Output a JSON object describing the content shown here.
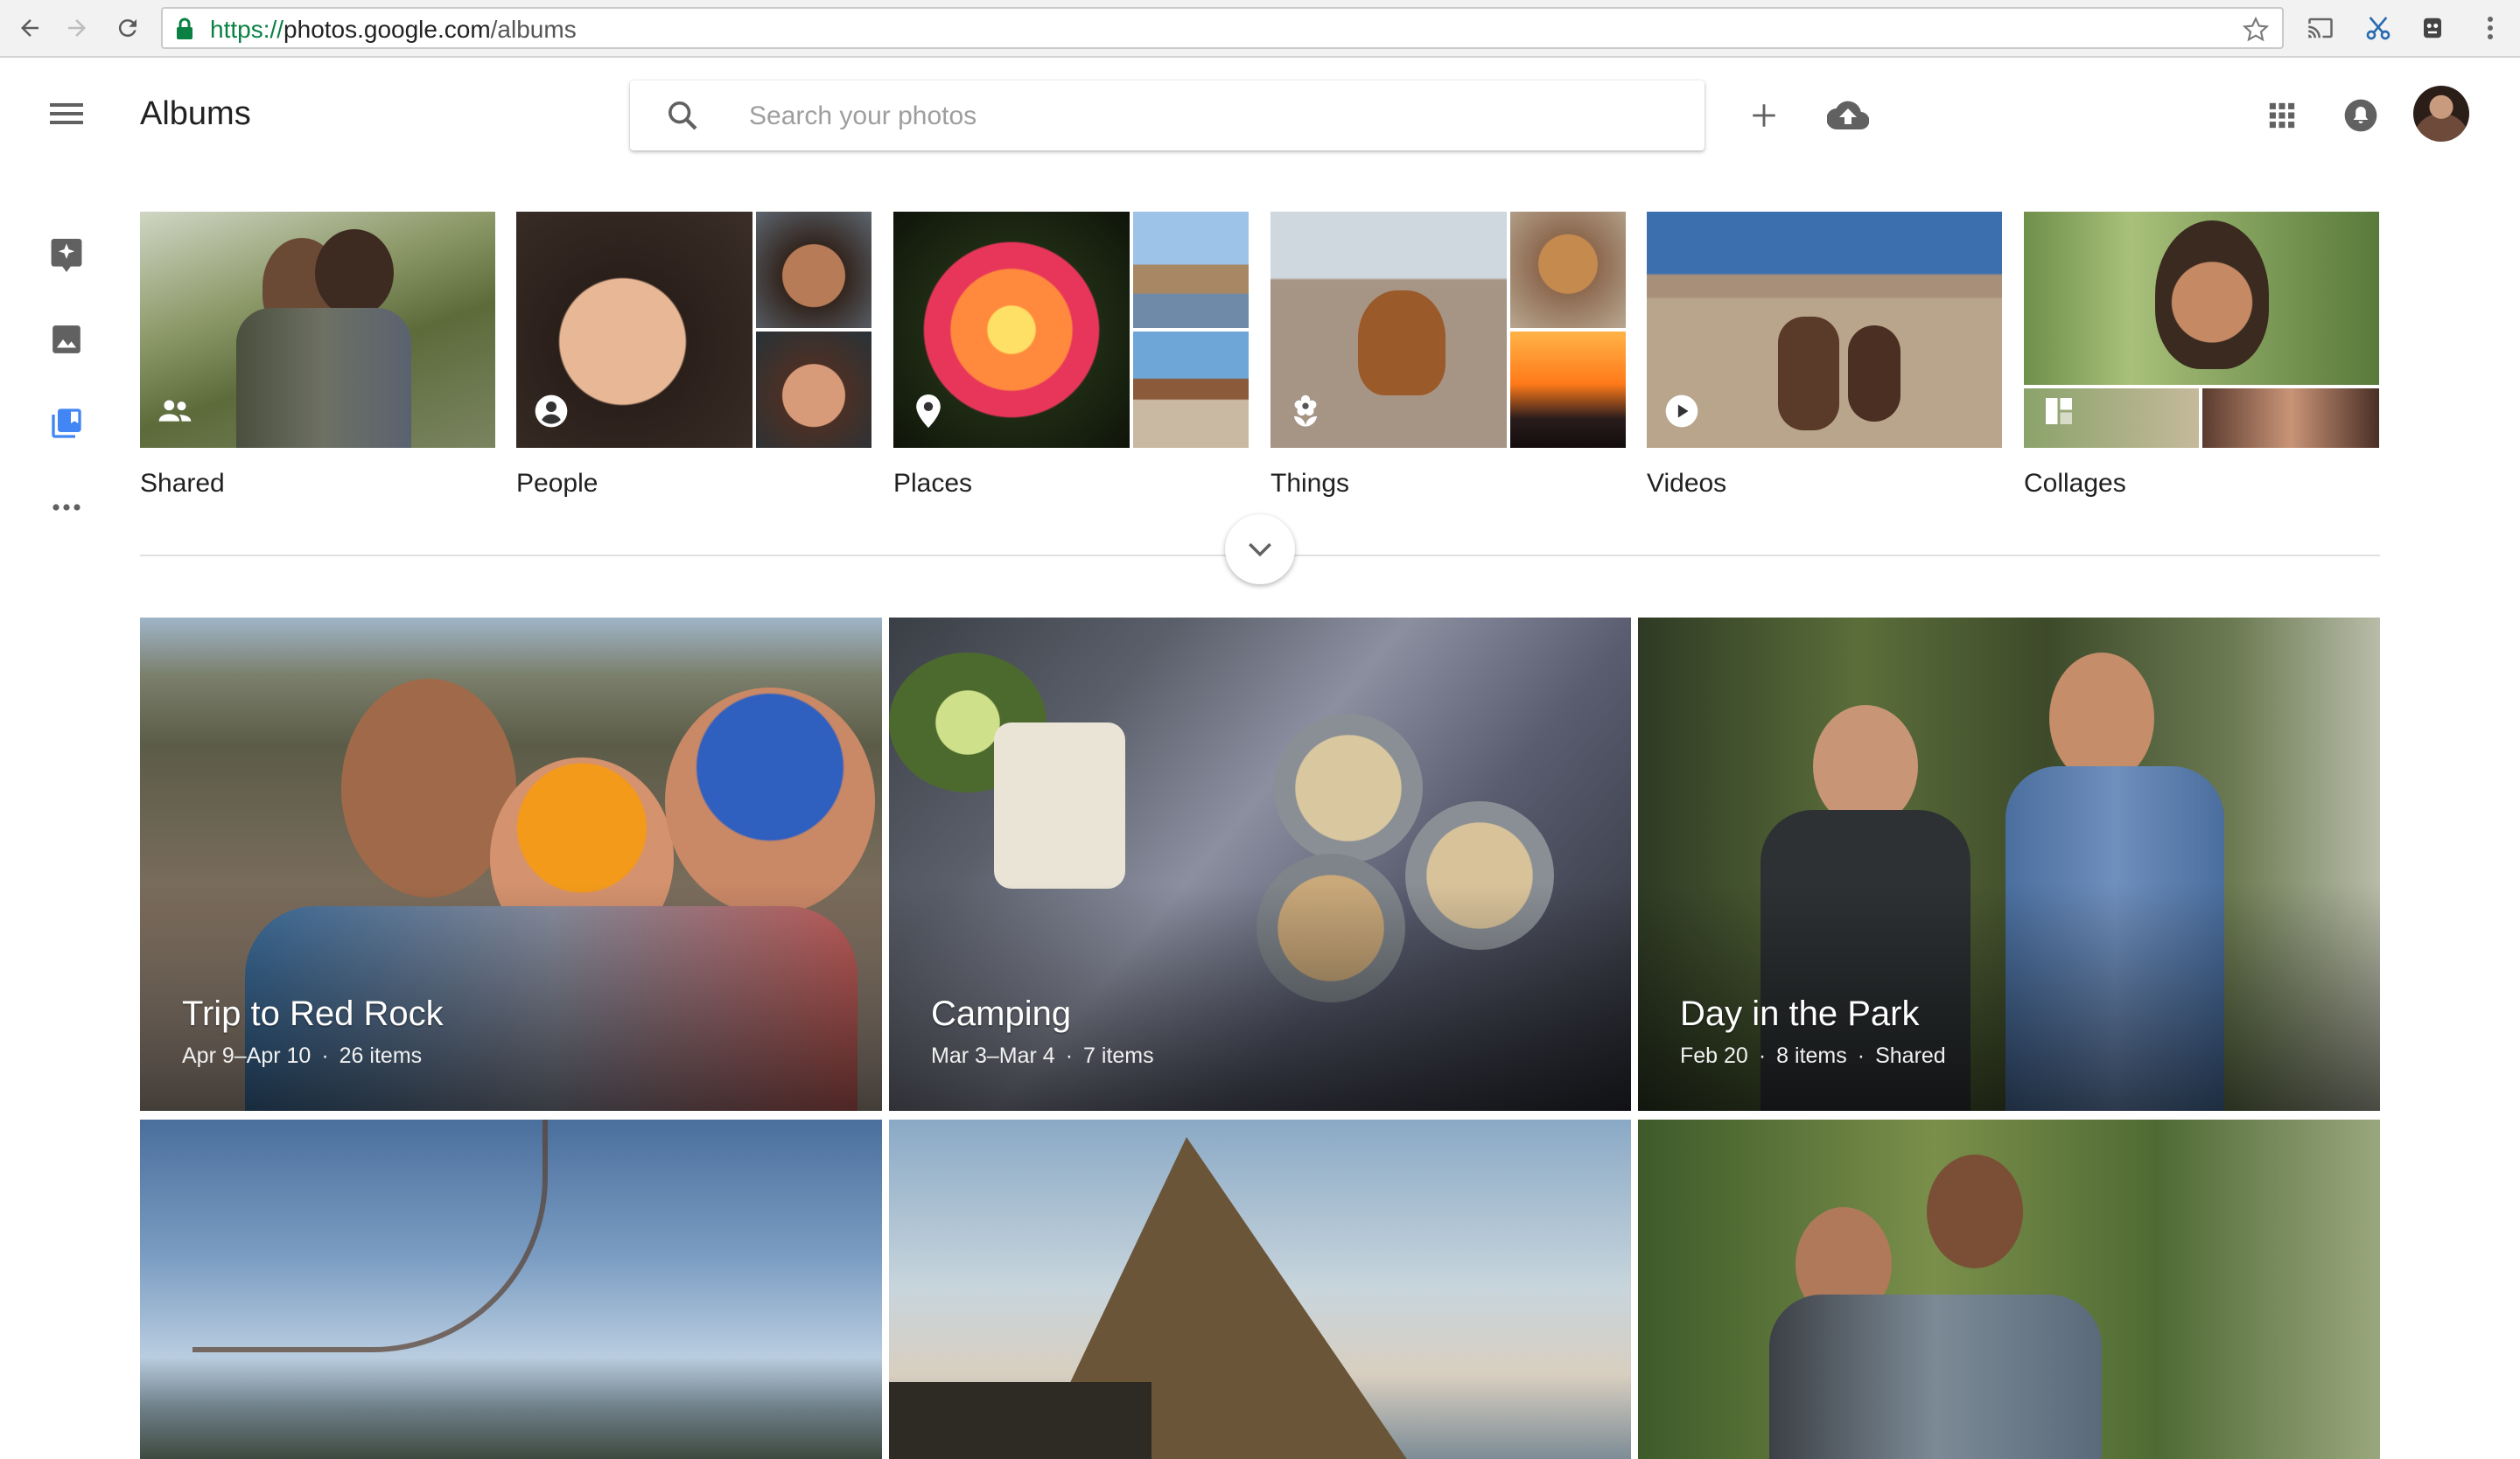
{
  "browser": {
    "url_scheme": "https://",
    "url_host": "photos.google.com",
    "url_path": "/albums"
  },
  "header": {
    "title": "Albums",
    "search_placeholder": "Search your photos"
  },
  "rail": {
    "items": [
      "assistant-icon",
      "photos-icon",
      "albums-icon",
      "more-icon"
    ],
    "active_color": "#4285f4"
  },
  "categories": [
    {
      "label": "Shared",
      "icon": "people-icon"
    },
    {
      "label": "People",
      "icon": "person-icon"
    },
    {
      "label": "Places",
      "icon": "place-icon"
    },
    {
      "label": "Things",
      "icon": "flower-icon"
    },
    {
      "label": "Videos",
      "icon": "play-icon"
    },
    {
      "label": "Collages",
      "icon": "collage-icon"
    }
  ],
  "albums": [
    {
      "title": "Trip to Red Rock",
      "dates": "Apr 9–Apr 10",
      "count": "26 items",
      "shared": ""
    },
    {
      "title": "Camping",
      "dates": "Mar 3–Mar 4",
      "count": "7 items",
      "shared": ""
    },
    {
      "title": "Day in the Park",
      "dates": "Feb 20",
      "count": "8 items",
      "shared": "Shared"
    },
    {
      "title": "",
      "dates": "",
      "count": "",
      "shared": ""
    },
    {
      "title": "",
      "dates": "",
      "count": "",
      "shared": ""
    },
    {
      "title": "",
      "dates": "",
      "count": "",
      "shared": ""
    }
  ]
}
